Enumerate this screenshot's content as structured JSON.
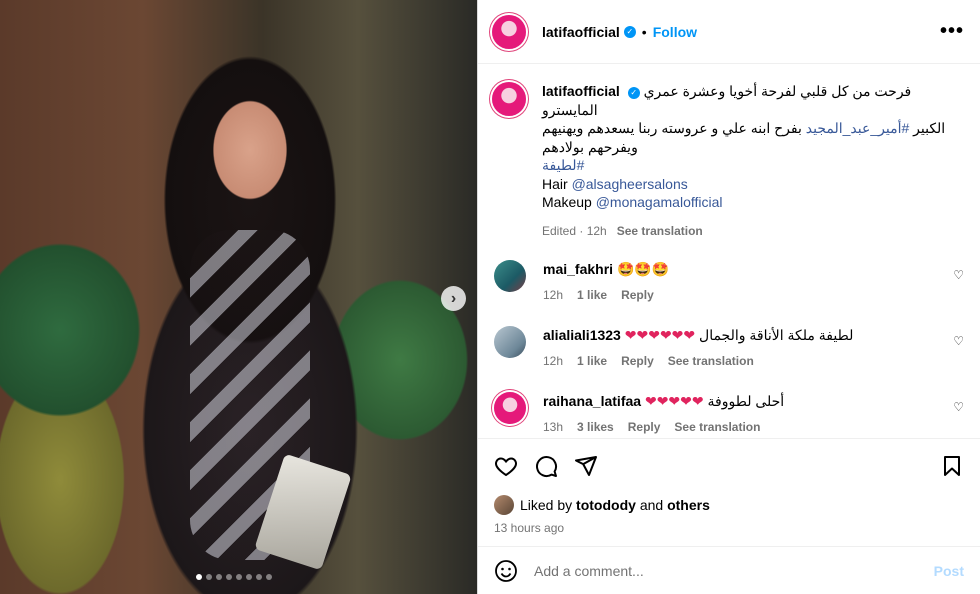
{
  "post": {
    "username": "latifaofficial",
    "follow_label": "Follow",
    "more_icon": "•••"
  },
  "caption": {
    "username": "latifaofficial",
    "line1": "فرحت من كل قلبي لفرحة أخويا وعشرة عمري المايسترو",
    "line2_prefix": "الكبير ",
    "line2_tag": "#أمير_عبد_المجيد",
    "line2_suffix": " بفرح ابنه علي و عروسته ربنا يسعدهم ويهنيهم",
    "line3": "ويفرحهم بولادهم",
    "hashtag": "#لطيفة",
    "hair_label": "Hair ",
    "hair_handle": "@alsagheersalons",
    "makeup_label": "Makeup ",
    "makeup_handle": "@monagamalofficial",
    "edited": "Edited · 12h",
    "see_translation": "See translation"
  },
  "comments": [
    {
      "username": "mai_fakhri",
      "text": "🤩🤩🤩",
      "time": "12h",
      "likes": "1 like",
      "reply": "Reply",
      "translation": ""
    },
    {
      "username": "alialiali1323",
      "text": "لطيفة ملكة الأناقة والجمال ❤️❤️❤️❤️❤️❤️",
      "time": "12h",
      "likes": "1 like",
      "reply": "Reply",
      "translation": "See translation"
    },
    {
      "username": "raihana_latifaa",
      "text": "أحلى لطووفة ❤️❤️❤️❤️❤️",
      "time": "13h",
      "likes": "3 likes",
      "reply": "Reply",
      "translation": "See translation"
    }
  ],
  "likes": {
    "prefix": "Liked by ",
    "user": "totodody",
    "middle": " and ",
    "others": "others"
  },
  "posted": "13 hours ago",
  "add_comment": {
    "placeholder": "Add a comment...",
    "post_label": "Post"
  },
  "carousel": {
    "total": 8,
    "active": 0
  },
  "colors": {
    "accent": "#0095f6",
    "heart": "#e0245e",
    "muted": "#737373"
  }
}
